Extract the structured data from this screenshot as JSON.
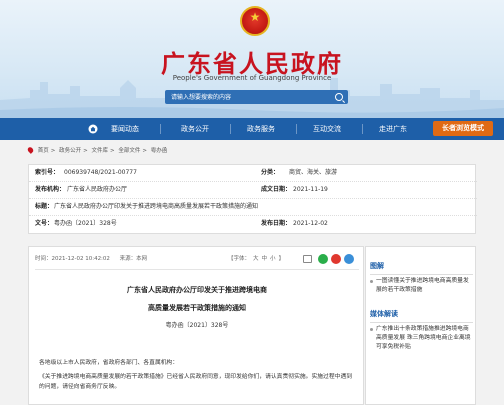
{
  "header": {
    "title": "广东省人民政府",
    "subtitle": "People's Government of Guangdong Province",
    "search_placeholder": "请输入想要搜索的内容"
  },
  "nav": {
    "items": [
      "要闻动态",
      "政务公开",
      "政务服务",
      "互动交流",
      "走进广东"
    ],
    "elder_mode": "长者浏览模式"
  },
  "breadcrumb": [
    "首页",
    "政务公开",
    "文件库",
    "全部文件",
    "粤办函"
  ],
  "meta": {
    "index_label": "索引号：",
    "index_value": "006939748/2021-00777",
    "category_label": "分类：",
    "category_value": "商贸、海关、旅游",
    "issuer_label": "发布机构：",
    "issuer_value": "广东省人民政府办公厅",
    "created_label": "成文日期：",
    "created_value": "2021-11-19",
    "title_label": "标题：",
    "title_value": "广东省人民政府办公厅印发关于推进跨境电商高质量发展若干政策措施的通知",
    "docno_label": "文号：",
    "docno_value": "粤办函〔2021〕328号",
    "published_label": "发布日期：",
    "published_value": "2021-12-02"
  },
  "article": {
    "time_text": "时间：2021-12-02 10:42:02",
    "source_text": "来源：本网",
    "fontsize_label": "【字体：",
    "fontsize_big": "大",
    "fontsize_mid": "中",
    "fontsize_small": "小",
    "fontsize_end": "】",
    "title_line1": "广东省人民政府办公厅印发关于推进跨境电商",
    "title_line2": "高质量发展若干政策措施的通知",
    "doc_number": "粤办函〔2021〕328号",
    "para1": "各地级以上市人民政府，省政府各部门、各直属机构：",
    "para2": "《关于推进跨境电商高质量发展的若干政策措施》已经省人民政府同意，现印发给你们，请认真贯彻实施。实施过程中遇到的问题，请径向省商务厅反映。"
  },
  "sidebar": {
    "section1_title": "图解",
    "section1_link": "一图读懂关于推进跨境电商高质量发展的若干政策措施",
    "section2_title": "媒体解读",
    "section2_link": "广东推出十条政策措施推进跨境电商高质量发展 珠三角跨境电商企业离境可享免税补贴"
  },
  "colors": {
    "brand_red": "#c8131f",
    "nav_blue": "#1e5fa8",
    "elder_orange": "#e06a14"
  }
}
